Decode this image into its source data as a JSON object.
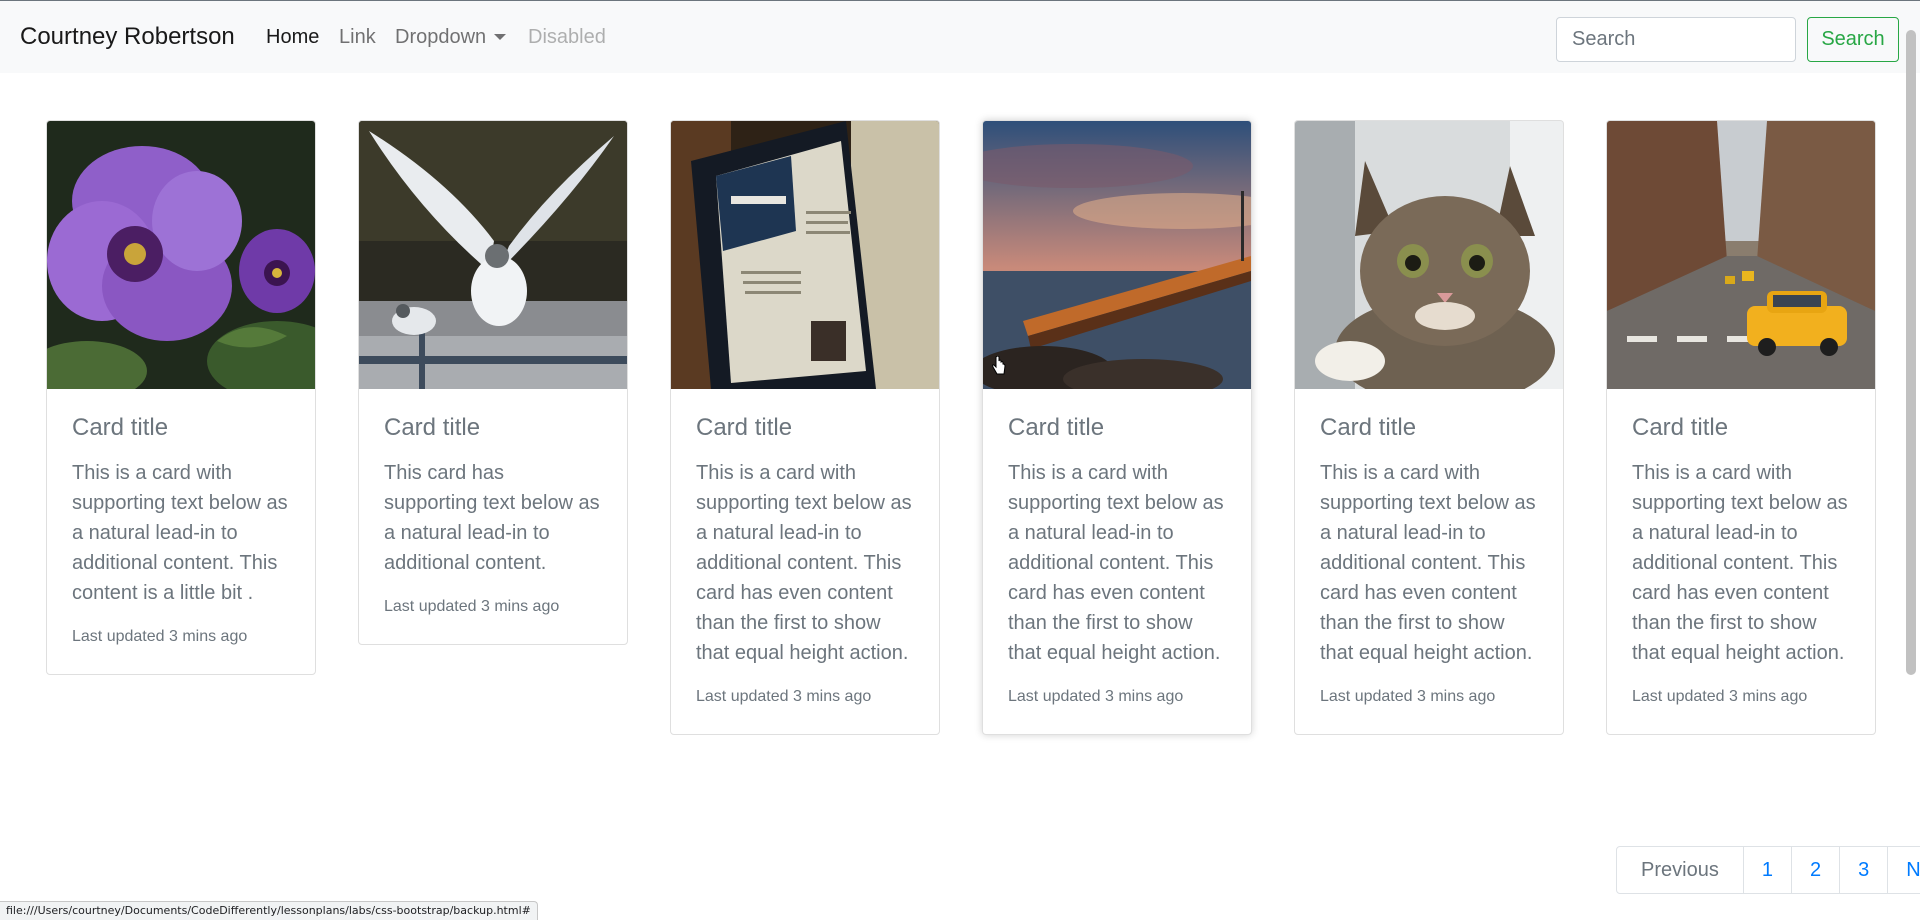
{
  "navbar": {
    "brand": "Courtney Robertson",
    "links": [
      {
        "label": "Home",
        "state": "active"
      },
      {
        "label": "Link",
        "state": "normal"
      },
      {
        "label": "Dropdown",
        "state": "dropdown"
      },
      {
        "label": "Disabled",
        "state": "disabled"
      }
    ],
    "search_placeholder": "Search",
    "search_button": "Search"
  },
  "cards": [
    {
      "image": "purple-flower-image",
      "title": "Card title",
      "text": "This is a card with supporting text below as a natural lead-in to additional content. This content is a little bit .",
      "footer": "Last updated 3 mins ago"
    },
    {
      "image": "seagull-image",
      "title": "Card title",
      "text": "This card has supporting text below as a natural lead-in to additional content.",
      "footer": "Last updated 3 mins ago"
    },
    {
      "image": "tablet-welcome-image",
      "title": "Card title",
      "text": "This is a card with supporting text below as a natural lead-in to additional content. This card has even content than the first to show that equal height action.",
      "footer": "Last updated 3 mins ago"
    },
    {
      "image": "pier-sunset-image",
      "title": "Card title",
      "text": "This is a card with supporting text below as a natural lead-in to additional content. This card has even content than the first to show that equal height action.",
      "footer": "Last updated 3 mins ago"
    },
    {
      "image": "kitten-image",
      "title": "Card title",
      "text": "This is a card with supporting text below as a natural lead-in to additional content. This card has even content than the first to show that equal height action.",
      "footer": "Last updated 3 mins ago"
    },
    {
      "image": "city-taxi-image",
      "title": "Card title",
      "text": "This is a card with supporting text below as a natural lead-in to additional content. This card has even content than the first to show that equal height action.",
      "footer": "Last updated 3 mins ago"
    }
  ],
  "pagination": {
    "previous": "Previous",
    "pages": [
      "1",
      "2",
      "3"
    ],
    "next": "Next"
  },
  "status_url": "file:///Users/courtney/Documents/CodeDifferently/lessonplans/labs/css-bootstrap/backup.html#",
  "colors": {
    "navbar_bg": "#f8f9fa",
    "success": "#28a745",
    "link": "#007bff",
    "muted": "#6c757d"
  }
}
